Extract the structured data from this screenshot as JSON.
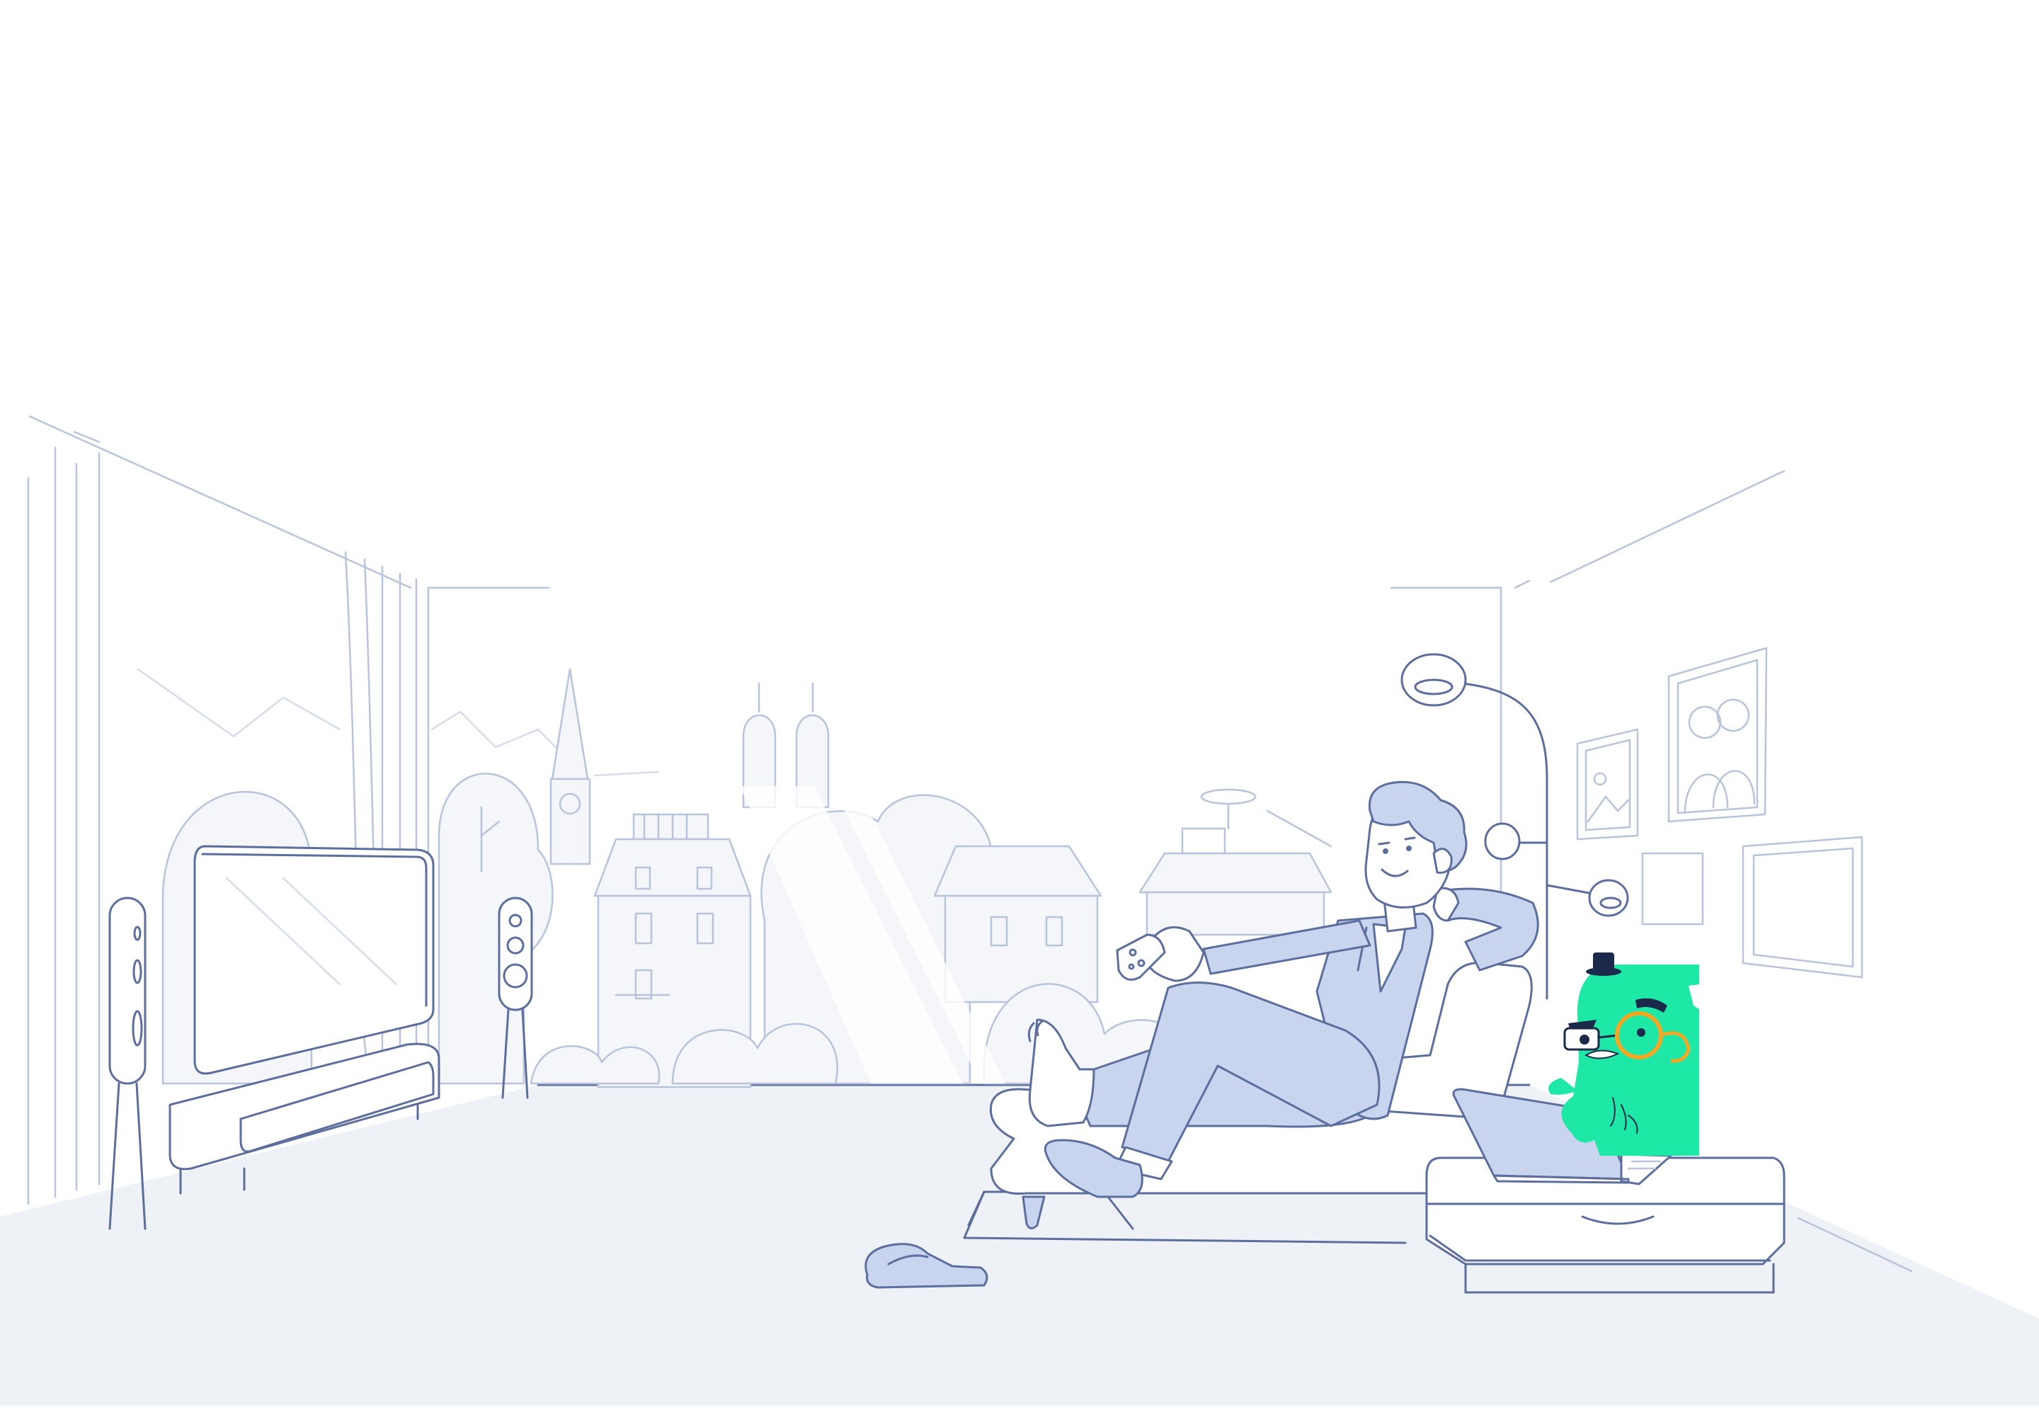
{
  "scene": {
    "description_label": "",
    "colors": {
      "line": "#5b6e9e",
      "line_light": "#b8c4dc",
      "floor": "#eef1f6",
      "accent_blue": "#c9d4ef",
      "mascot_green": "#1ee8a6",
      "mascot_monocle": "#f5a623",
      "mascot_hat": "#1b2a4a"
    }
  }
}
